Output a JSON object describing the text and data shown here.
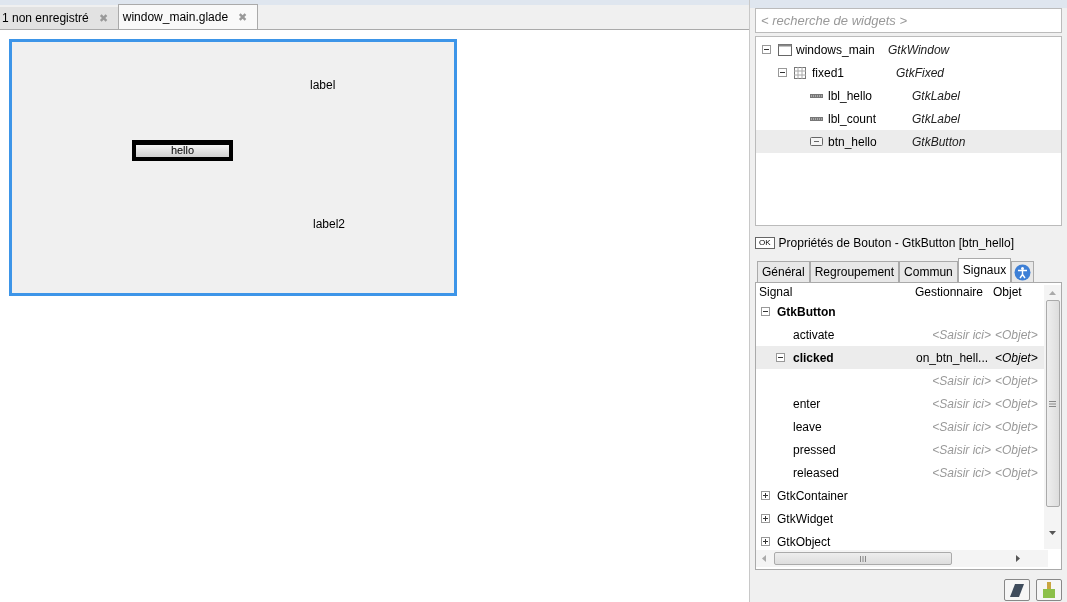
{
  "tabs": [
    {
      "label": "1 non enregistré",
      "selected": false,
      "close": "✖"
    },
    {
      "label": "window_main.glade",
      "selected": true,
      "close": "✖"
    }
  ],
  "canvas": {
    "selected": true,
    "widgets": [
      {
        "kind": "label",
        "text": "label",
        "selected": false
      },
      {
        "kind": "button",
        "text": "hello",
        "selected": true
      },
      {
        "kind": "label",
        "text": "label2",
        "selected": false
      }
    ]
  },
  "search": {
    "placeholder": "< recherche de widgets >"
  },
  "tree": [
    {
      "name": "windows_main",
      "type": "GtkWindow",
      "kind": "window",
      "selected": false,
      "expanded": true,
      "children": [
        {
          "name": "fixed1",
          "type": "GtkFixed",
          "kind": "grid",
          "selected": false,
          "expanded": true,
          "children": [
            {
              "name": "lbl_hello",
              "type": "GtkLabel",
              "kind": "label",
              "selected": false
            },
            {
              "name": "lbl_count",
              "type": "GtkLabel",
              "kind": "label",
              "selected": false
            },
            {
              "name": "btn_hello",
              "type": "GtkButton",
              "kind": "button",
              "selected": true
            }
          ]
        }
      ]
    }
  ],
  "properties": {
    "badge": "OK",
    "title": "Propriétés de Bouton - GtkButton [btn_hello]"
  },
  "prop_tabs": [
    {
      "label": "Général",
      "selected": false
    },
    {
      "label": "Regroupement",
      "selected": false
    },
    {
      "label": "Commun",
      "selected": false
    },
    {
      "label": "Signaux",
      "selected": true
    }
  ],
  "signals": {
    "columns": [
      "Signal",
      "Gestionnaire",
      "Objet"
    ],
    "groups": [
      {
        "name": "GtkButton",
        "expanded": true,
        "signals": [
          {
            "name": "activate",
            "handler": "<Saisir ici>",
            "object": "<Objet>",
            "set": false,
            "selected": false
          },
          {
            "name": "clicked",
            "handler": "on_btn_hell...",
            "object": "<Objet>",
            "set": true,
            "selected": true,
            "expanded": true,
            "children": [
              {
                "handler": "<Saisir ici>",
                "object": "<Objet>"
              }
            ]
          },
          {
            "name": "enter",
            "handler": "<Saisir ici>",
            "object": "<Objet>",
            "set": false,
            "selected": false
          },
          {
            "name": "leave",
            "handler": "<Saisir ici>",
            "object": "<Objet>",
            "set": false,
            "selected": false
          },
          {
            "name": "pressed",
            "handler": "<Saisir ici>",
            "object": "<Objet>",
            "set": false,
            "selected": false
          },
          {
            "name": "released",
            "handler": "<Saisir ici>",
            "object": "<Objet>",
            "set": false,
            "selected": false
          }
        ]
      },
      {
        "name": "GtkContainer",
        "expanded": false
      },
      {
        "name": "GtkWidget",
        "expanded": false
      },
      {
        "name": "GtkObject",
        "expanded": false
      }
    ]
  }
}
